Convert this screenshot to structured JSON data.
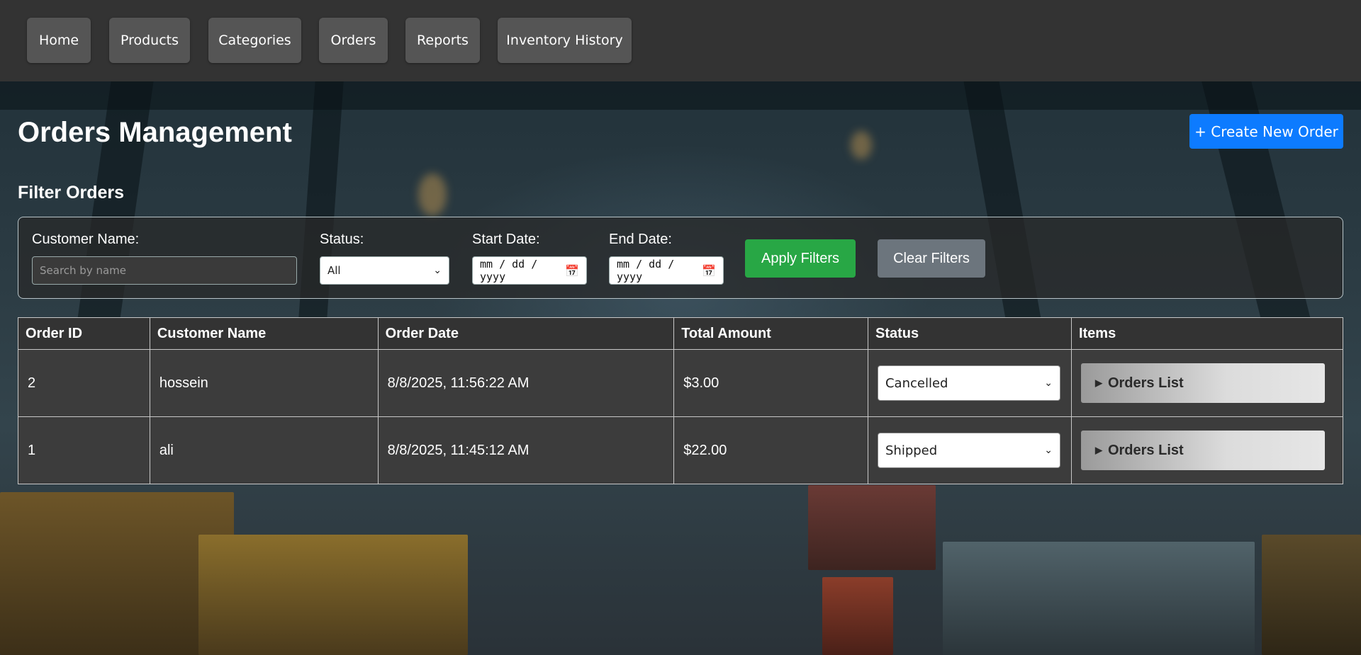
{
  "nav": {
    "items": [
      "Home",
      "Products",
      "Categories",
      "Orders",
      "Reports",
      "Inventory History"
    ]
  },
  "page": {
    "title": "Orders Management",
    "create_button": "+ Create New Order",
    "filter_title": "Filter Orders"
  },
  "filters": {
    "customer_label": "Customer Name:",
    "customer_placeholder": "Search by name",
    "status_label": "Status:",
    "status_value": "All",
    "start_label": "Start Date:",
    "start_value": "mm / dd / yyyy",
    "end_label": "End Date:",
    "end_value": "mm / dd / yyyy",
    "apply_button": "Apply Filters",
    "clear_button": "Clear Filters"
  },
  "table": {
    "headers": [
      "Order ID",
      "Customer Name",
      "Order Date",
      "Total Amount",
      "Status",
      "Items"
    ],
    "rows": [
      {
        "id": "2",
        "customer": "hossein",
        "date": "8/8/2025, 11:56:22 AM",
        "total": "$3.00",
        "status": "Cancelled",
        "items_button": "Orders List"
      },
      {
        "id": "1",
        "customer": "ali",
        "date": "8/8/2025, 11:45:12 AM",
        "total": "$22.00",
        "status": "Shipped",
        "items_button": "Orders List"
      }
    ]
  },
  "colors": {
    "nav_bg": "#333333",
    "nav_button": "#555555",
    "create_button": "#0d7bff",
    "apply_button": "#28a745",
    "clear_button": "#6c757d"
  },
  "icons": {
    "dropdown": "chevron-down-icon",
    "date": "calendar-icon",
    "expand": "triangle-right-icon"
  }
}
